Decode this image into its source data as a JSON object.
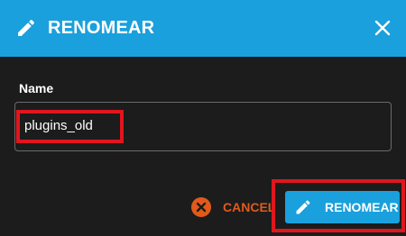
{
  "dialog": {
    "title": "RENOMEAR",
    "header_icon": "pencil-icon",
    "close_icon": "close-icon",
    "accent_color": "#1aa0dc"
  },
  "form": {
    "name_label": "Name",
    "name_value": "plugins_old"
  },
  "actions": {
    "cancel_label": "CANCEL",
    "cancel_icon": "cancel-circle-icon",
    "cancel_color": "#e05a1c",
    "confirm_label": "RENOMEAR",
    "confirm_icon": "pencil-icon"
  },
  "annotations": {
    "highlight_color": "#e0161e"
  }
}
